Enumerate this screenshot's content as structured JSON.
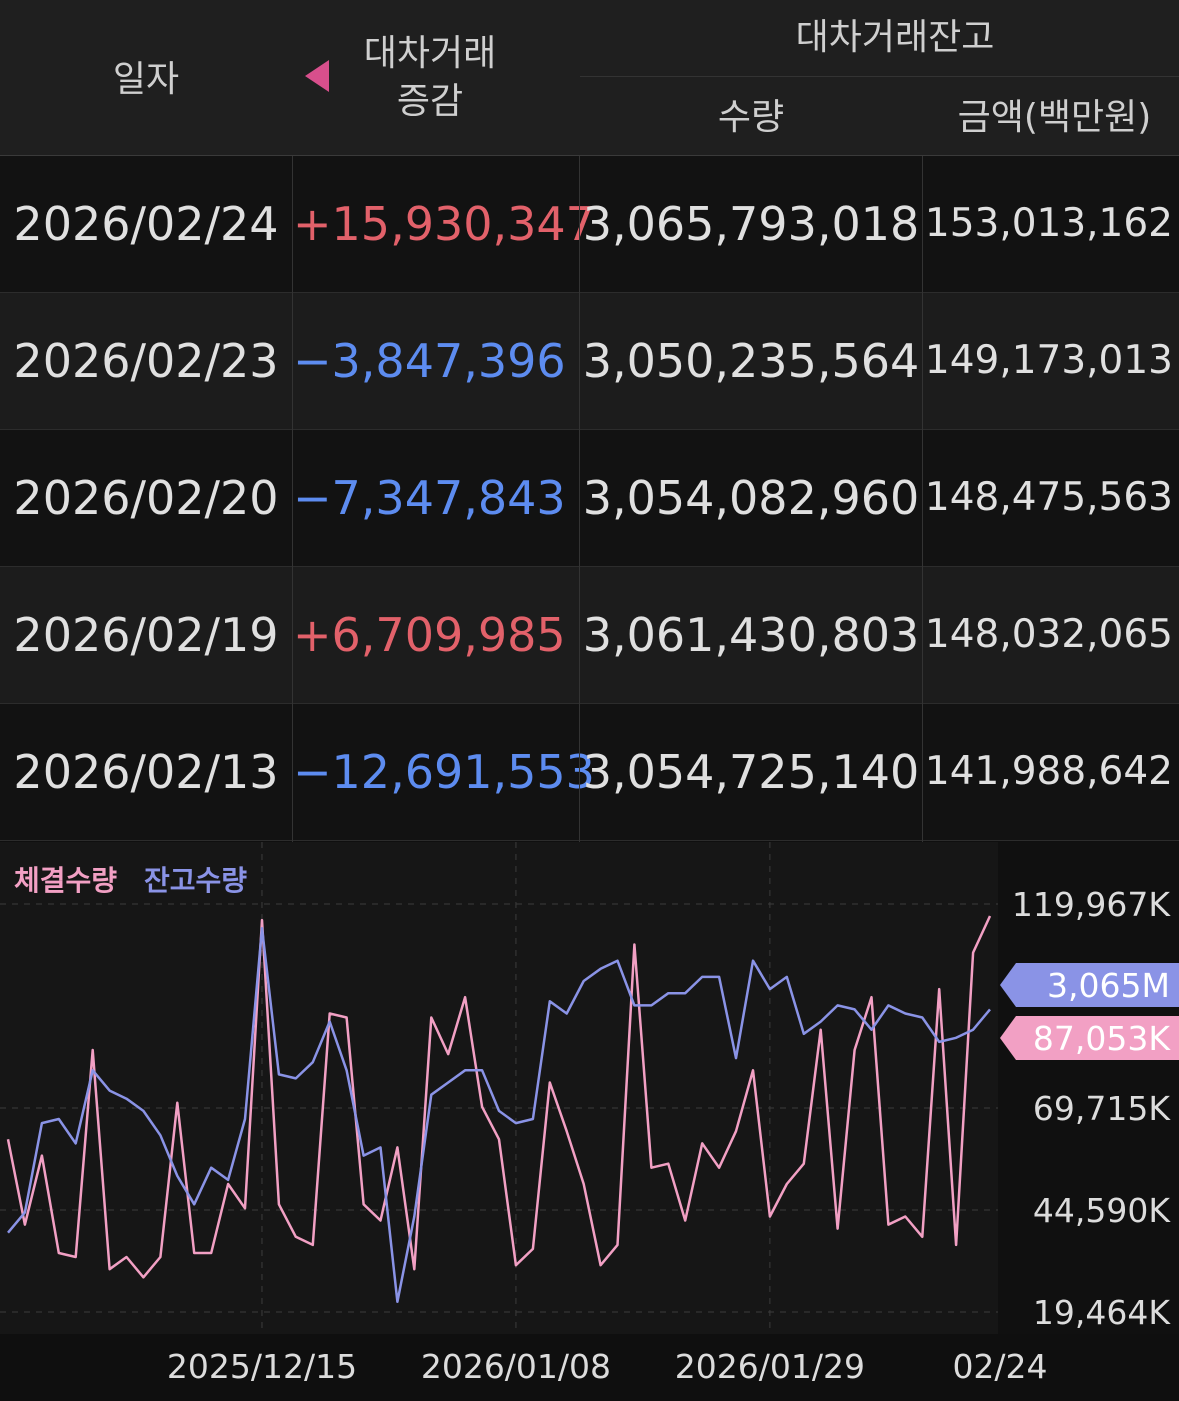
{
  "header": {
    "date_label": "일자",
    "change_label_1": "대차거래",
    "change_label_2": "증감",
    "balance_label": "대차거래잔고",
    "qty_label": "수량",
    "amount_label": "금액(백만원)"
  },
  "rows": [
    {
      "date": "2026/02/24",
      "change": "+15,930,347",
      "dir": "up",
      "qty": "3,065,793,018",
      "amount": "153,013,162"
    },
    {
      "date": "2026/02/23",
      "change": "−3,847,396",
      "dir": "down",
      "qty": "3,050,235,564",
      "amount": "149,173,013"
    },
    {
      "date": "2026/02/20",
      "change": "−7,347,843",
      "dir": "down",
      "qty": "3,054,082,960",
      "amount": "148,475,563"
    },
    {
      "date": "2026/02/19",
      "change": "+6,709,985",
      "dir": "up",
      "qty": "3,061,430,803",
      "amount": "148,032,065"
    },
    {
      "date": "2026/02/13",
      "change": "−12,691,553",
      "dir": "down",
      "qty": "3,054,725,140",
      "amount": "141,988,642"
    }
  ],
  "colors": {
    "up": "#e2616a",
    "down": "#5d8cf0",
    "pink": "#f2a0c4",
    "blue": "#8a93e6"
  },
  "chart_data": {
    "type": "line",
    "legend": [
      "체결수량",
      "잔고수량"
    ],
    "y_ticks": [
      "119,967K",
      "69,715K",
      "44,590K",
      "19,464K"
    ],
    "y_ticks_values": [
      119967,
      69715,
      44590,
      19464
    ],
    "ylim": [
      19464,
      119967
    ],
    "x_ticks": [
      "2025/12/15",
      "2026/01/08",
      "2026/01/29",
      "02/24"
    ],
    "x_ticks_index": [
      15,
      30,
      45,
      59
    ],
    "badge_balance": "3,065M",
    "badge_volume": "87,053K",
    "series": [
      {
        "name": "체결수량",
        "color": "#f2a0c4",
        "values": [
          62000,
          41000,
          58000,
          34000,
          33000,
          84000,
          30000,
          33000,
          28000,
          33000,
          71000,
          34000,
          34000,
          51000,
          45000,
          116000,
          46000,
          38000,
          36000,
          93000,
          92000,
          46000,
          42000,
          60000,
          30000,
          92000,
          83000,
          97000,
          70000,
          62000,
          31000,
          35000,
          76000,
          64000,
          51000,
          31000,
          36000,
          110000,
          55000,
          56000,
          42000,
          61000,
          55000,
          64000,
          79000,
          43000,
          51000,
          56000,
          89000,
          40000,
          84000,
          97000,
          41000,
          43000,
          38000,
          99000,
          36000,
          108000,
          117000
        ]
      },
      {
        "name": "잔고수량",
        "color": "#8a93e6",
        "values": [
          39000,
          44000,
          66000,
          67000,
          61000,
          79000,
          74000,
          72000,
          69000,
          63000,
          53000,
          46000,
          55000,
          52000,
          67000,
          114000,
          78000,
          77000,
          81000,
          91000,
          79000,
          58000,
          60000,
          22000,
          43000,
          73000,
          76000,
          79000,
          79000,
          69000,
          66000,
          67000,
          96000,
          93000,
          101000,
          104000,
          106000,
          95000,
          95000,
          98000,
          98000,
          102000,
          102000,
          82000,
          106000,
          99000,
          102000,
          88000,
          91000,
          95000,
          94000,
          89000,
          95000,
          93000,
          92000,
          86000,
          87000,
          89000,
          94000
        ]
      }
    ]
  }
}
